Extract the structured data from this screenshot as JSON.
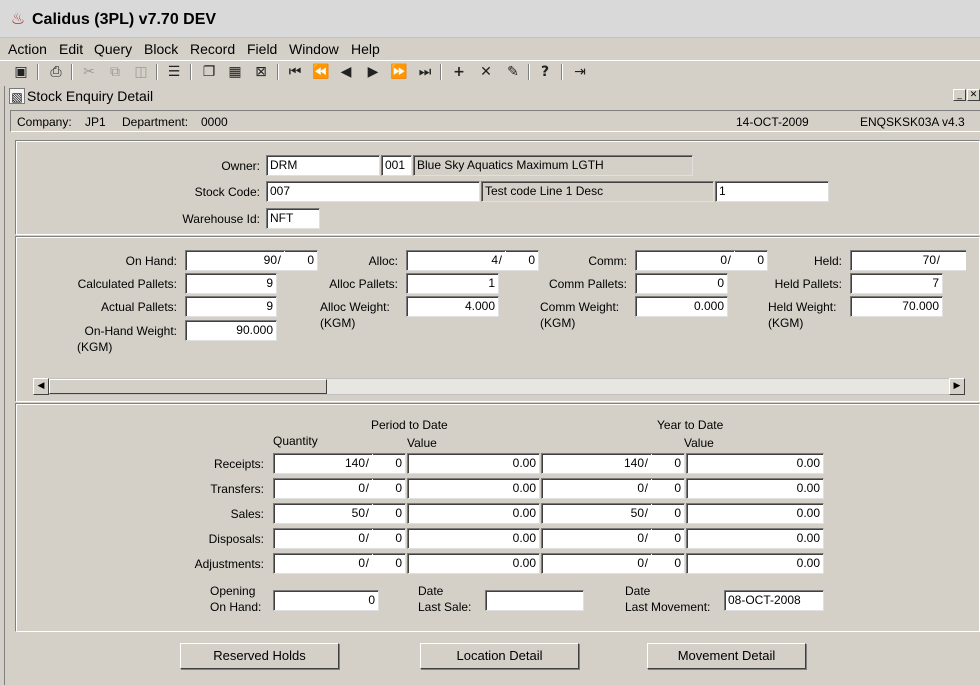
{
  "app": {
    "title": "Calidus (3PL) v7.70 DEV"
  },
  "menu": [
    {
      "label": "Action"
    },
    {
      "label": "Edit"
    },
    {
      "label": "Query"
    },
    {
      "label": "Block"
    },
    {
      "label": "Record"
    },
    {
      "label": "Field"
    },
    {
      "label": "Window"
    },
    {
      "label": "Help"
    }
  ],
  "toolbar": [
    "save-icon",
    "print-icon",
    "cut-icon",
    "copy-icon",
    "paste-icon",
    "list-icon",
    "duplicate-icon",
    "stack-icon",
    "clear-icon",
    "first-record-icon",
    "prev-page-icon",
    "prev-record-icon",
    "next-record-icon",
    "next-page-icon",
    "last-record-icon",
    "insert-icon",
    "delete-icon",
    "edit-icon",
    "help-icon",
    "exit-icon"
  ],
  "window": {
    "title": "Stock Enquiry Detail"
  },
  "info": {
    "company_label": "Company:",
    "company": "JP1",
    "department_label": "Department:",
    "department": "0000",
    "date": "14-OCT-2009",
    "form_code": "ENQSKSK03A  v4.3"
  },
  "header": {
    "owner_label": "Owner:",
    "owner": "DRM",
    "owner_num": "001",
    "owner_desc": "Blue Sky Aquatics Maximum LGTH",
    "stock_label": "Stock Code:",
    "stock_code": "007",
    "stock_desc": "Test code Line 1 Desc",
    "stock_extra": "1",
    "warehouse_label": "Warehouse Id:",
    "warehouse": "NFT"
  },
  "levels": {
    "on_hand_label": "On Hand:",
    "on_hand_whole": "90",
    "on_hand_frac": "0",
    "calc_pallets_label": "Calculated Pallets:",
    "calc_pallets": "9",
    "actual_pallets_label": "Actual Pallets:",
    "actual_pallets": "9",
    "on_hand_weight_label": "On-Hand Weight:",
    "on_hand_weight_unit": "(KGM)",
    "on_hand_weight": "90.000",
    "alloc_label": "Alloc:",
    "alloc_whole": "4",
    "alloc_frac": "0",
    "alloc_pallets_label": "Alloc Pallets:",
    "alloc_pallets": "1",
    "alloc_weight_label": "Alloc Weight:",
    "alloc_weight_unit": "(KGM)",
    "alloc_weight": "4.000",
    "comm_label": "Comm:",
    "comm_whole": "0",
    "comm_frac": "0",
    "comm_pallets_label": "Comm Pallets:",
    "comm_pallets": "0",
    "comm_weight_label": "Comm Weight:",
    "comm_weight_unit": "(KGM)",
    "comm_weight": "0.000",
    "held_label": "Held:",
    "held_whole": "70",
    "held_pallets_label": "Held Pallets:",
    "held_pallets": "7",
    "held_weight_label": "Held Weight:",
    "held_weight_unit": "(KGM)",
    "held_weight": "70.000"
  },
  "movements": {
    "ptd_title": "Period to Date",
    "ytd_title": "Year to Date",
    "quantity_header": "Quantity",
    "value_header": "Value",
    "value_header_ytd": "Value",
    "rows": [
      {
        "label": "Receipts:",
        "ptd_qty": "140",
        "ptd_frac": "0",
        "ptd_val": "0.00",
        "ytd_qty": "140",
        "ytd_frac": "0",
        "ytd_val": "0.00"
      },
      {
        "label": "Transfers:",
        "ptd_qty": "0",
        "ptd_frac": "0",
        "ptd_val": "0.00",
        "ytd_qty": "0",
        "ytd_frac": "0",
        "ytd_val": "0.00"
      },
      {
        "label": "Sales:",
        "ptd_qty": "50",
        "ptd_frac": "0",
        "ptd_val": "0.00",
        "ytd_qty": "50",
        "ytd_frac": "0",
        "ytd_val": "0.00"
      },
      {
        "label": "Disposals:",
        "ptd_qty": "0",
        "ptd_frac": "0",
        "ptd_val": "0.00",
        "ytd_qty": "0",
        "ytd_frac": "0",
        "ytd_val": "0.00"
      },
      {
        "label": "Adjustments:",
        "ptd_qty": "0",
        "ptd_frac": "0",
        "ptd_val": "0.00",
        "ytd_qty": "0",
        "ytd_frac": "0",
        "ytd_val": "0.00"
      }
    ],
    "opening_label_1": "Opening",
    "opening_label_2": "On Hand:",
    "opening": "0",
    "last_sale_label_1": "Date",
    "last_sale_label_2": "Last Sale:",
    "last_sale": "",
    "last_move_label_1": "Date",
    "last_move_label_2": "Last Movement:",
    "last_move": "08-OCT-2008"
  },
  "buttons": {
    "reserved": "Reserved Holds",
    "location": "Location Detail",
    "movement": "Movement Detail"
  }
}
